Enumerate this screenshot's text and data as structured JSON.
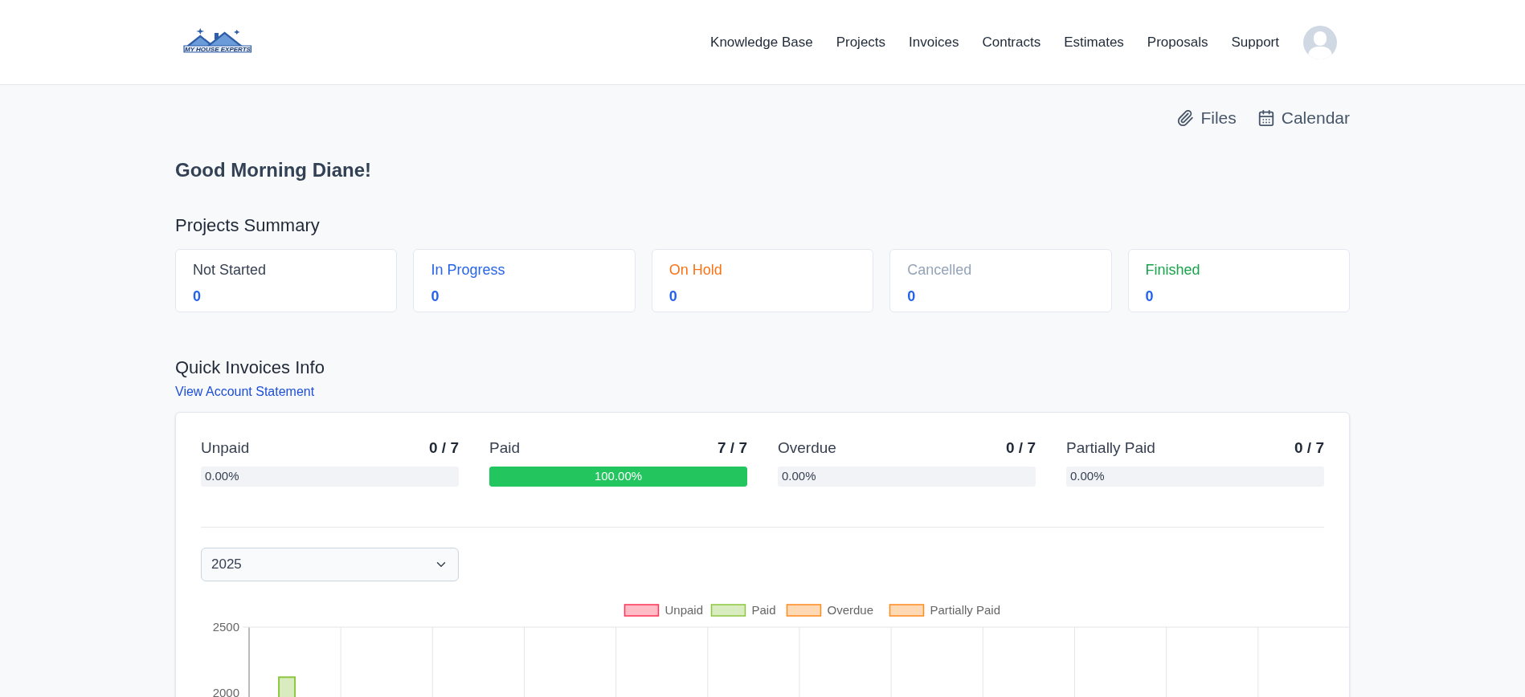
{
  "header": {
    "logo_text": "MY HOUSE EXPERTS",
    "nav": [
      "Knowledge Base",
      "Projects",
      "Invoices",
      "Contracts",
      "Estimates",
      "Proposals",
      "Support"
    ]
  },
  "actions": [
    {
      "kind": "files",
      "label": "Files"
    },
    {
      "kind": "calendar",
      "label": "Calendar"
    }
  ],
  "greeting": "Good Morning Diane!",
  "projects_summary": {
    "title": "Projects Summary",
    "cards": [
      {
        "label": "Not Started",
        "count": "0",
        "color": "#374151"
      },
      {
        "label": "In Progress",
        "count": "0",
        "color": "#2563eb"
      },
      {
        "label": "On Hold",
        "count": "0",
        "color": "#f97316"
      },
      {
        "label": "Cancelled",
        "count": "0",
        "color": "#94a3b8"
      },
      {
        "label": "Finished",
        "count": "0",
        "color": "#16a34a"
      }
    ]
  },
  "quick_invoices": {
    "title": "Quick Invoices Info",
    "link": "View Account Statement",
    "stats": [
      {
        "label": "Unpaid",
        "count": "0 / 7",
        "level": 0,
        "reading": "0.00%"
      },
      {
        "label": "Paid",
        "count": "7 / 7",
        "level": 1,
        "reading": "100.00%"
      },
      {
        "label": "Overdue",
        "count": "0 / 7",
        "level": 0,
        "reading": "0.00%"
      },
      {
        "label": "Partially Paid",
        "count": "0 / 7",
        "level": 0,
        "reading": "0.00%"
      }
    ],
    "year_select": {
      "value": "2025"
    },
    "chart_data": {
      "type": "bar",
      "ylim": [
        0,
        2500
      ],
      "yticks": [
        2000,
        2500
      ],
      "series": [
        {
          "name": "Unpaid",
          "color": "#ff3355",
          "values": [
            0,
            0,
            0,
            0,
            0,
            0,
            0,
            0,
            0,
            0,
            0,
            0
          ]
        },
        {
          "name": "Paid",
          "color": "#8cc63f",
          "values": [
            2120,
            0,
            0,
            0,
            0,
            0,
            0,
            0,
            0,
            0,
            0,
            0
          ]
        },
        {
          "name": "Overdue",
          "color": "#ff8a1f",
          "values": [
            0,
            0,
            0,
            0,
            0,
            0,
            0,
            0,
            0,
            0,
            0,
            0
          ]
        },
        {
          "name": "Partially Paid",
          "color": "#ff8a1f",
          "values": [
            0,
            0,
            0,
            0,
            0,
            0,
            0,
            0,
            0,
            0,
            0,
            0
          ]
        }
      ]
    }
  }
}
